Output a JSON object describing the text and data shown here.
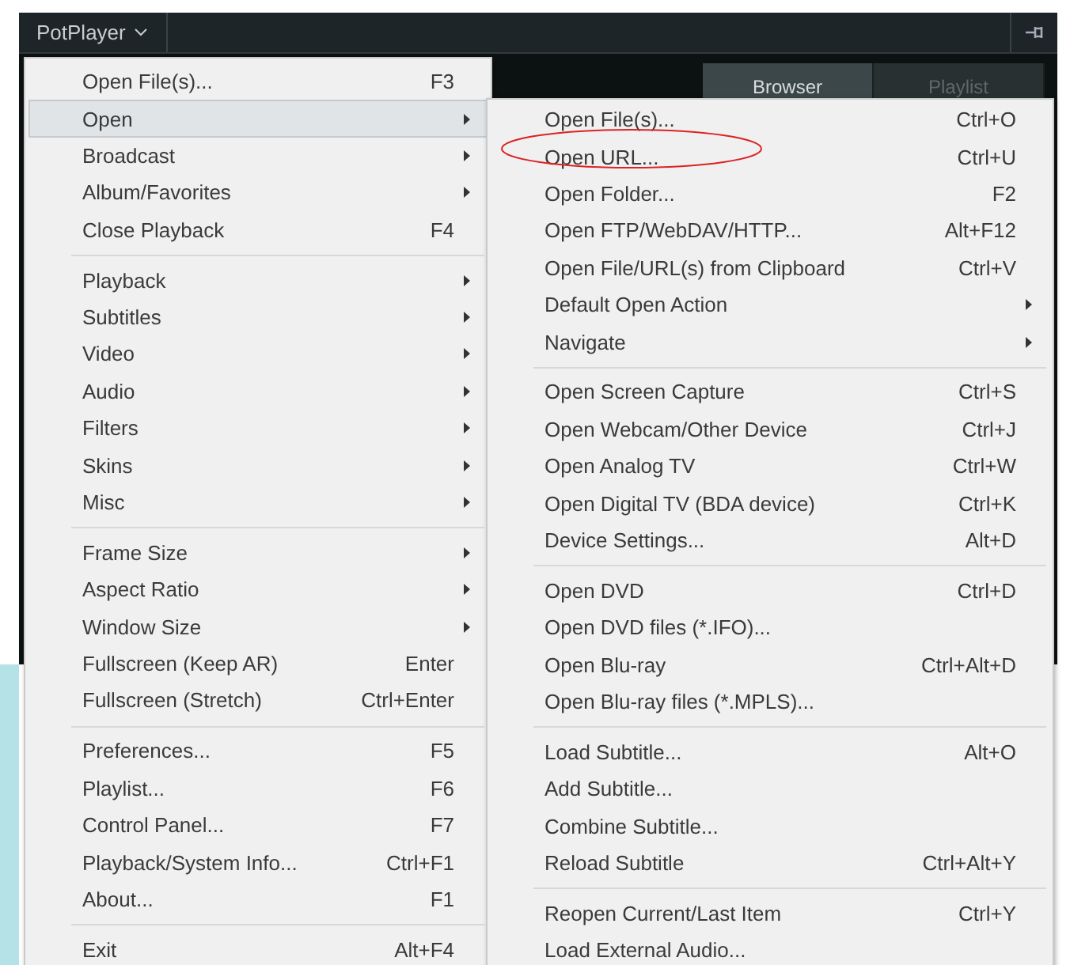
{
  "window": {
    "title": "PotPlayer",
    "tabs": [
      {
        "label": "Browser",
        "selected": true
      },
      {
        "label": "Playlist",
        "selected": false
      }
    ]
  },
  "main_menu": [
    {
      "kind": "item",
      "label": "Open File(s)...",
      "shortcut": "F3",
      "submenu": false,
      "selected": false
    },
    {
      "kind": "item",
      "label": "Open",
      "submenu": true,
      "selected": true
    },
    {
      "kind": "item",
      "label": "Broadcast",
      "submenu": true,
      "selected": false
    },
    {
      "kind": "item",
      "label": "Album/Favorites",
      "submenu": true,
      "selected": false
    },
    {
      "kind": "item",
      "label": "Close Playback",
      "shortcut": "F4",
      "submenu": false,
      "selected": false
    },
    {
      "kind": "separator"
    },
    {
      "kind": "item",
      "label": "Playback",
      "submenu": true,
      "selected": false
    },
    {
      "kind": "item",
      "label": "Subtitles",
      "submenu": true,
      "selected": false
    },
    {
      "kind": "item",
      "label": "Video",
      "submenu": true,
      "selected": false
    },
    {
      "kind": "item",
      "label": "Audio",
      "submenu": true,
      "selected": false
    },
    {
      "kind": "item",
      "label": "Filters",
      "submenu": true,
      "selected": false
    },
    {
      "kind": "item",
      "label": "Skins",
      "submenu": true,
      "selected": false
    },
    {
      "kind": "item",
      "label": "Misc",
      "submenu": true,
      "selected": false
    },
    {
      "kind": "separator"
    },
    {
      "kind": "item",
      "label": "Frame Size",
      "submenu": true,
      "selected": false
    },
    {
      "kind": "item",
      "label": "Aspect Ratio",
      "submenu": true,
      "selected": false
    },
    {
      "kind": "item",
      "label": "Window Size",
      "submenu": true,
      "selected": false
    },
    {
      "kind": "item",
      "label": "Fullscreen (Keep AR)",
      "shortcut": "Enter",
      "submenu": false,
      "selected": false
    },
    {
      "kind": "item",
      "label": "Fullscreen (Stretch)",
      "shortcut": "Ctrl+Enter",
      "submenu": false,
      "selected": false
    },
    {
      "kind": "separator"
    },
    {
      "kind": "item",
      "label": "Preferences...",
      "shortcut": "F5",
      "submenu": false,
      "selected": false
    },
    {
      "kind": "item",
      "label": "Playlist...",
      "shortcut": "F6",
      "submenu": false,
      "selected": false
    },
    {
      "kind": "item",
      "label": "Control Panel...",
      "shortcut": "F7",
      "submenu": false,
      "selected": false
    },
    {
      "kind": "item",
      "label": "Playback/System Info...",
      "shortcut": "Ctrl+F1",
      "submenu": false,
      "selected": false
    },
    {
      "kind": "item",
      "label": "About...",
      "shortcut": "F1",
      "submenu": false,
      "selected": false
    },
    {
      "kind": "separator"
    },
    {
      "kind": "item",
      "label": "Exit",
      "shortcut": "Alt+F4",
      "submenu": false,
      "selected": false
    }
  ],
  "open_submenu": [
    {
      "kind": "item",
      "label": "Open File(s)...",
      "shortcut": "Ctrl+O",
      "submenu": false,
      "circled": false
    },
    {
      "kind": "item",
      "label": "Open URL...",
      "shortcut": "Ctrl+U",
      "submenu": false,
      "circled": true
    },
    {
      "kind": "item",
      "label": "Open Folder...",
      "shortcut": "F2",
      "submenu": false,
      "circled": false
    },
    {
      "kind": "item",
      "label": "Open FTP/WebDAV/HTTP...",
      "shortcut": "Alt+F12",
      "submenu": false,
      "circled": false
    },
    {
      "kind": "item",
      "label": "Open File/URL(s) from Clipboard",
      "shortcut": "Ctrl+V",
      "submenu": false,
      "circled": false
    },
    {
      "kind": "item",
      "label": "Default Open Action",
      "submenu": true,
      "circled": false
    },
    {
      "kind": "item",
      "label": "Navigate",
      "submenu": true,
      "circled": false
    },
    {
      "kind": "separator"
    },
    {
      "kind": "item",
      "label": "Open Screen Capture",
      "shortcut": "Ctrl+S",
      "submenu": false,
      "circled": false
    },
    {
      "kind": "item",
      "label": "Open Webcam/Other Device",
      "shortcut": "Ctrl+J",
      "submenu": false,
      "circled": false
    },
    {
      "kind": "item",
      "label": "Open Analog TV",
      "shortcut": "Ctrl+W",
      "submenu": false,
      "circled": false
    },
    {
      "kind": "item",
      "label": "Open Digital TV (BDA device)",
      "shortcut": "Ctrl+K",
      "submenu": false,
      "circled": false
    },
    {
      "kind": "item",
      "label": "Device Settings...",
      "shortcut": "Alt+D",
      "submenu": false,
      "circled": false
    },
    {
      "kind": "separator"
    },
    {
      "kind": "item",
      "label": "Open DVD",
      "shortcut": "Ctrl+D",
      "submenu": false,
      "circled": false
    },
    {
      "kind": "item",
      "label": "Open DVD files (*.IFO)...",
      "submenu": false,
      "circled": false
    },
    {
      "kind": "item",
      "label": "Open Blu-ray",
      "shortcut": "Ctrl+Alt+D",
      "submenu": false,
      "circled": false
    },
    {
      "kind": "item",
      "label": "Open Blu-ray files (*.MPLS)...",
      "submenu": false,
      "circled": false
    },
    {
      "kind": "separator"
    },
    {
      "kind": "item",
      "label": "Load Subtitle...",
      "shortcut": "Alt+O",
      "submenu": false,
      "circled": false
    },
    {
      "kind": "item",
      "label": "Add Subtitle...",
      "submenu": false,
      "circled": false
    },
    {
      "kind": "item",
      "label": "Combine Subtitle...",
      "submenu": false,
      "circled": false
    },
    {
      "kind": "item",
      "label": "Reload Subtitle",
      "shortcut": "Ctrl+Alt+Y",
      "submenu": false,
      "circled": false
    },
    {
      "kind": "separator"
    },
    {
      "kind": "item",
      "label": "Reopen Current/Last Item",
      "shortcut": "Ctrl+Y",
      "submenu": false,
      "circled": false
    },
    {
      "kind": "item",
      "label": "Load External Audio...",
      "submenu": false,
      "circled": false
    }
  ]
}
